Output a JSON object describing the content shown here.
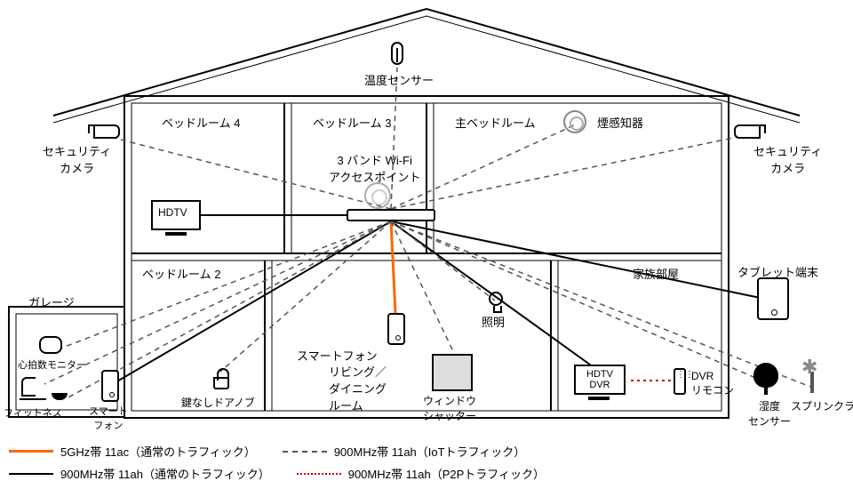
{
  "title_thermo": "温度センサー",
  "rooms": {
    "bed4": "ベッドルーム 4",
    "bed3": "ベッドルーム 3",
    "master": "主ベッドルーム",
    "bed2": "ベッドルーム 2",
    "family": "家族部屋",
    "living": "リビング／\nダイニング\nルーム",
    "garage": "ガレージ"
  },
  "ap_label": "3 バンド Wi-Fi\nアクセスポイント",
  "devices": {
    "smoke": "煙感知器",
    "cam_l": "セキュリティ\nカメラ",
    "cam_r": "セキュリティ\nカメラ",
    "hdtv": "HDTV",
    "tablet": "タブレット端末",
    "phone": "スマートフォン",
    "light": "照明",
    "shutter": "ウィンドウ\nシャッター",
    "hdtv_dvr": "HDTV\nDVR",
    "dvr_remote": "DVR\nリモコン",
    "humidity": "湿度\nセンサー",
    "sprinkler": "スプリンクラー",
    "lock": "鍵なしドアノブ",
    "heart": "心拍数モニター",
    "fitness": "フィットネス",
    "garage_phone": "スマート\nフォン"
  },
  "legend": {
    "a": "5GHz帯 11ac（通常のトラフィック）",
    "b": "900MHz帯 11ah（通常のトラフィック）",
    "c": "900MHz帯 11ah（IoTトラフィック）",
    "d": "900MHz帯 11ah（P2Pトラフィック）"
  }
}
